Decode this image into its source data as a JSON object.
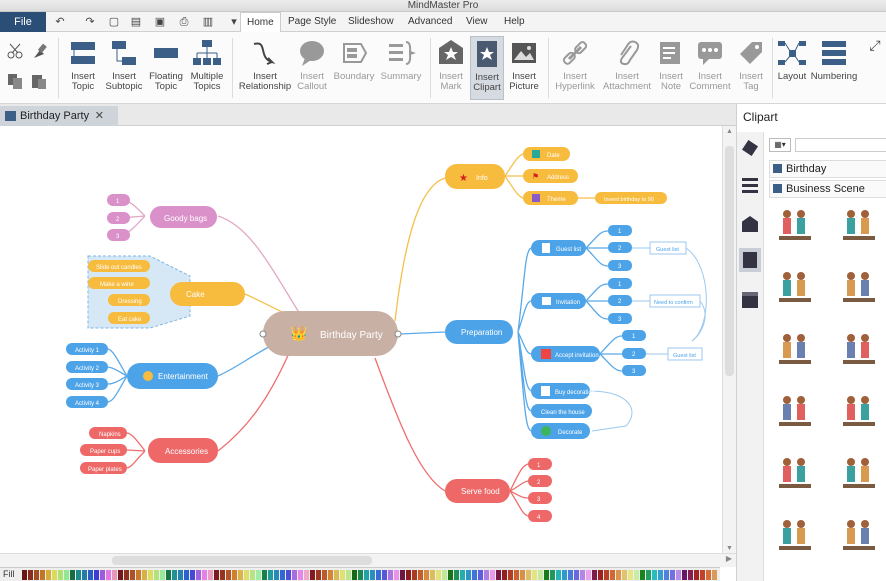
{
  "window": {
    "title": "MindMaster Pro"
  },
  "menu": {
    "file": "File",
    "tabs": [
      "Home",
      "Page Style",
      "Slideshow",
      "Advanced",
      "View",
      "Help"
    ]
  },
  "ribbon": {
    "buttons": [
      {
        "l1": "Insert",
        "l2": "Topic"
      },
      {
        "l1": "Insert",
        "l2": "Subtopic"
      },
      {
        "l1": "Floating",
        "l2": "Topic"
      },
      {
        "l1": "Multiple",
        "l2": "Topics"
      },
      {
        "l1": "Insert",
        "l2": "Relationship"
      },
      {
        "l1": "Insert",
        "l2": "Callout"
      },
      {
        "l1": "Boundary",
        "l2": ""
      },
      {
        "l1": "Summary",
        "l2": ""
      },
      {
        "l1": "Insert",
        "l2": "Mark"
      },
      {
        "l1": "Insert",
        "l2": "Clipart"
      },
      {
        "l1": "Insert",
        "l2": "Picture"
      },
      {
        "l1": "Insert",
        "l2": "Hyperlink"
      },
      {
        "l1": "Insert",
        "l2": "Attachment"
      },
      {
        "l1": "Insert",
        "l2": "Note"
      },
      {
        "l1": "Insert",
        "l2": "Comment"
      },
      {
        "l1": "Insert",
        "l2": "Tag"
      },
      {
        "l1": "Layout",
        "l2": ""
      },
      {
        "l1": "Numbering",
        "l2": ""
      }
    ]
  },
  "document": {
    "tab": "Birthday Party"
  },
  "map": {
    "center": "Birthday Party",
    "goody": {
      "label": "Goody bags",
      "items": [
        "1",
        "2",
        "3"
      ]
    },
    "cake": {
      "label": "Cake",
      "items": [
        "Slide out candles",
        "Make a wine",
        "Dressing",
        "Eat cake"
      ]
    },
    "entertainment": {
      "label": "Entertainment",
      "items": [
        "Activity 1",
        "Activity 2",
        "Activity 3",
        "Activity 4"
      ]
    },
    "accessories": {
      "label": "Accessories",
      "items": [
        "Napkins",
        "Paper cups",
        "Paper plates"
      ]
    },
    "info": {
      "label": "Info",
      "items": [
        "Date",
        "Address",
        "Theme"
      ],
      "note": "Invent birthday to 90"
    },
    "prep": {
      "label": "Preparation",
      "items": [
        "Guest list",
        "Invitation",
        "Accept invitation",
        "Buy decoration",
        "Clean the house",
        "Decorate"
      ],
      "nums": [
        "1",
        "2",
        "3"
      ],
      "notes": [
        "Guest list",
        "Need to confirm",
        "Guest list"
      ]
    },
    "serve": {
      "label": "Serve food",
      "items": [
        "1",
        "2",
        "3",
        "4"
      ]
    }
  },
  "sidebar": {
    "title": "Clipart",
    "categories": [
      "Birthday",
      "Business Scene"
    ]
  },
  "status": {
    "fill": "Fill"
  }
}
